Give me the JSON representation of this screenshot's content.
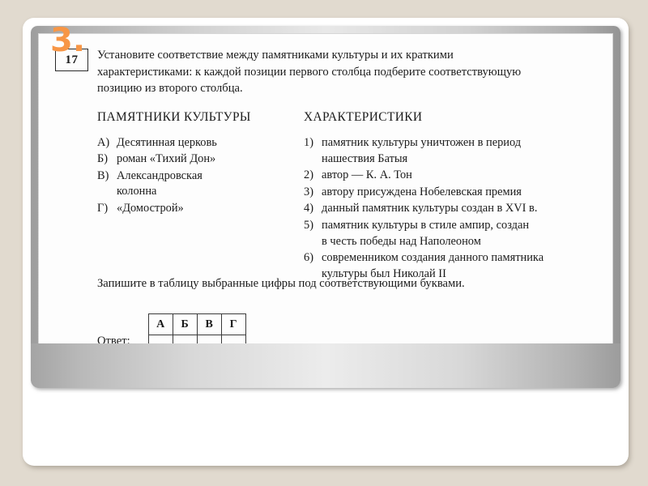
{
  "slide": {
    "number_label": "3.",
    "accent_color": "#f79646",
    "background_color": "#e1dacf"
  },
  "task": {
    "number": "17",
    "prompt_line1": "Установите соответствие между памятниками культуры и их краткими",
    "prompt_line2": "характеристиками: к каждой позиции первого столбца подберите соответствующую",
    "prompt_line3": "позицию из второго столбца."
  },
  "monuments": {
    "title": "ПАМЯТНИКИ КУЛЬТУРЫ",
    "items": [
      {
        "key": "А)",
        "text": "Десятинная церковь"
      },
      {
        "key": "Б)",
        "text": "роман «Тихий Дон»"
      },
      {
        "key": "В)",
        "text": "Александровская",
        "text2": "колонна"
      },
      {
        "key": "Г)",
        "text": "«Домострой»"
      }
    ]
  },
  "characteristics": {
    "title": "ХАРАКТЕРИСТИКИ",
    "items": [
      {
        "key": "1)",
        "text": "памятник культуры уничтожен в период",
        "text2": "нашествия Батыя"
      },
      {
        "key": "2)",
        "text": "автор — К. А. Тон"
      },
      {
        "key": "3)",
        "text": "автору присуждена Нобелевская премия"
      },
      {
        "key": "4)",
        "text": "данный памятник культуры создан в XVI в."
      },
      {
        "key": "5)",
        "text": "памятник культуры в стиле ампир, создан",
        "text2": "в честь победы над Наполеоном"
      },
      {
        "key": "6)",
        "text": "современником создания данного памятника",
        "text2": "культуры был Николай II"
      }
    ]
  },
  "answer": {
    "instruction": "Запишите в таблицу выбранные цифры под соответствующими буквами.",
    "label": "Ответ:",
    "headers": [
      "А",
      "Б",
      "В",
      "Г"
    ],
    "values": [
      "",
      "",
      "",
      ""
    ]
  }
}
